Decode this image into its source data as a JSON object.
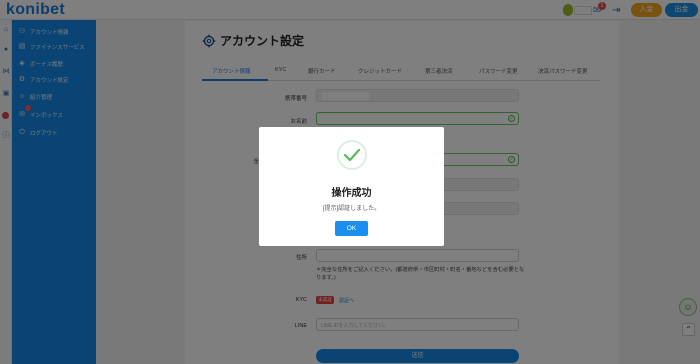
{
  "app": {
    "logo": "konibet"
  },
  "topbar": {
    "mail_badge": "1",
    "deposit_label": "入金",
    "withdraw_label": "出金"
  },
  "sidebar": {
    "items": [
      {
        "label": "アカウント情報",
        "icon": "user-icon"
      },
      {
        "label": "ファイナンスサービス",
        "icon": "finance-icon"
      },
      {
        "label": "ボーナス履歴",
        "icon": "gift-icon"
      },
      {
        "label": "アカウント設定",
        "icon": "gear-icon"
      },
      {
        "label": "紹介管理",
        "icon": "people-icon"
      },
      {
        "label": "インボックス",
        "icon": "mail-icon"
      },
      {
        "label": "ログアウト",
        "icon": "logout-icon"
      }
    ]
  },
  "page": {
    "title": "アカウント設定",
    "tabs": [
      "アカウント情報",
      "KYC",
      "銀行カード",
      "クレジットカード",
      "第三者決済",
      "パスワード変更",
      "決済パスワード変更"
    ],
    "active_tab": "アカウント情報"
  },
  "form": {
    "phone_label": "携帯番号",
    "name_label": "お名前",
    "partial_label": "全",
    "address_label": "住所",
    "address_note": "＊完全な住所をご記入ください。(都道府県・市区町村・町名・番地などを含む必要となります。)",
    "kyc_label": "KYC",
    "kyc_status": "未認証",
    "kyc_link": "認証へ",
    "line_label": "LINE",
    "line_placeholder": "LINE IDを入力してください。",
    "submit_label": "送信"
  },
  "dialog": {
    "title": "操作成功",
    "message": "[提示]認証しました。",
    "ok_label": "OK"
  },
  "colors": {
    "brand": "#1589e8",
    "success": "#6cc36b",
    "danger": "#e0413f",
    "deposit": "#f5a623"
  }
}
